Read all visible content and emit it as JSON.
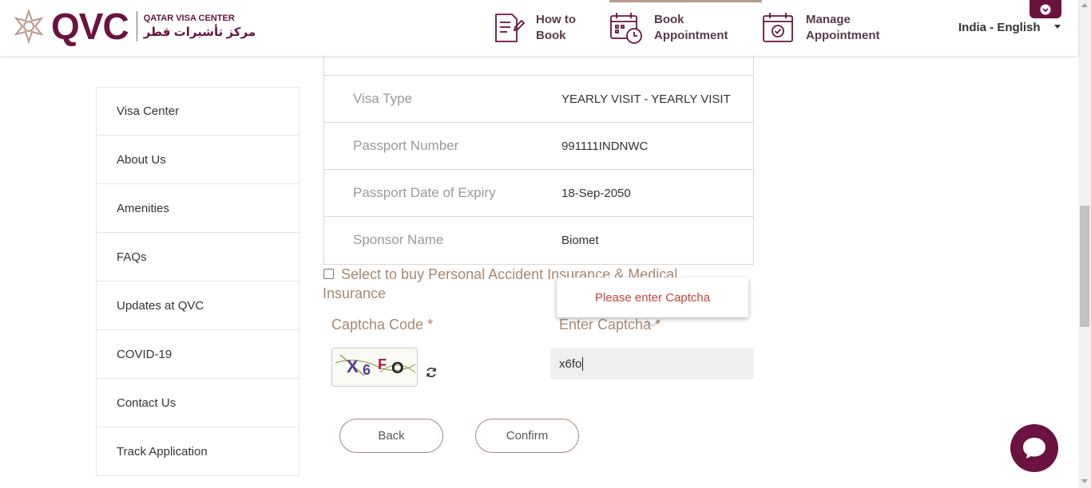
{
  "header": {
    "logo_text": "QVC",
    "logo_subtitle_en": "QATAR VISA CENTER",
    "logo_subtitle_ar": "مركز تأشيرات قطر",
    "nav": [
      {
        "line1": "How to",
        "line2": "Book",
        "icon": "document-edit-icon"
      },
      {
        "line1": "Book",
        "line2": "Appointment",
        "icon": "calendar-clock-icon",
        "active": true
      },
      {
        "line1": "Manage",
        "line2": "Appointment",
        "icon": "calendar-check-icon"
      }
    ],
    "language": "India - English"
  },
  "sidebar": {
    "items": [
      {
        "label": "Visa Center"
      },
      {
        "label": "About Us"
      },
      {
        "label": "Amenities"
      },
      {
        "label": "FAQs"
      },
      {
        "label": "Updates at QVC"
      },
      {
        "label": "COVID-19"
      },
      {
        "label": "Contact Us"
      },
      {
        "label": "Track Application"
      }
    ]
  },
  "details": {
    "rows": [
      {
        "label": "Visa Type",
        "value": "YEARLY VISIT - YEARLY VISIT"
      },
      {
        "label": "Passport Number",
        "value": "991111INDNWC"
      },
      {
        "label": "Passport Date of Expiry",
        "value": "18-Sep-2050"
      },
      {
        "label": "Sponsor Name",
        "value": "Biomet"
      }
    ]
  },
  "form": {
    "insurance_label": "Select to buy Personal Accident Insurance & Medical Insurance",
    "insurance_checked": false,
    "captcha_code_label": "Captcha Code *",
    "captcha_text": "X6FO",
    "enter_captcha_label": "Enter Captcha *",
    "captcha_value": "x6fo",
    "tooltip": "Please enter Captcha",
    "back_label": "Back",
    "confirm_label": "Confirm"
  },
  "colors": {
    "brand": "#6b1240",
    "label_tan": "#a88870",
    "error": "#d0403a"
  }
}
